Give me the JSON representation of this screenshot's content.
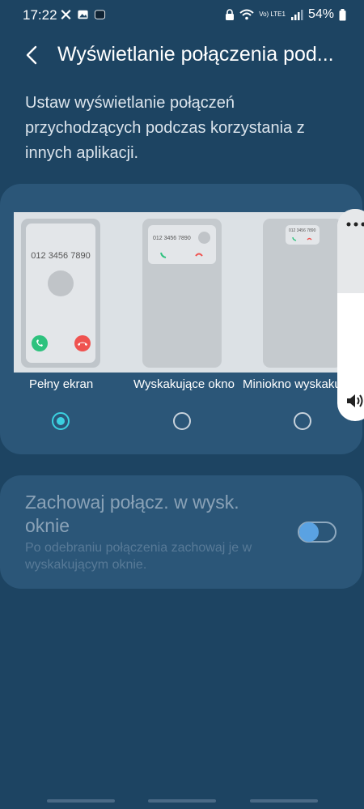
{
  "status_bar": {
    "time": "17:22",
    "network_label": "Vo) LTE1",
    "battery_percent": "54%",
    "left_icons": [
      "notification-icon",
      "gallery-icon",
      "app-icon"
    ]
  },
  "app_bar": {
    "title": "Wyświetlanie połączenia pod..."
  },
  "description": "Ustaw wyświetlanie połączeń przychodzących podczas korzystania z innych aplikacji.",
  "display_options": [
    {
      "label": "Pełny ekran",
      "selected": true,
      "preview_number": "012 3456 7890"
    },
    {
      "label": "Wyskakujące okno",
      "selected": false,
      "preview_number": "012 3456 7890"
    },
    {
      "label": "Miniokno wyskaku",
      "selected": false,
      "preview_number": "012 3456 7890"
    }
  ],
  "keep_in_popup": {
    "title": "Zachowaj połącz. w wysk. oknie",
    "subtitle": "Po odebraniu połączenia zachowaj je w wyskakującym oknie.",
    "enabled": true
  },
  "colors": {
    "background": "#1d4462",
    "card": "#2b5678",
    "accent_radio": "#3bd0e0",
    "accept_call": "#2ec27e",
    "decline_call": "#ef5350"
  }
}
